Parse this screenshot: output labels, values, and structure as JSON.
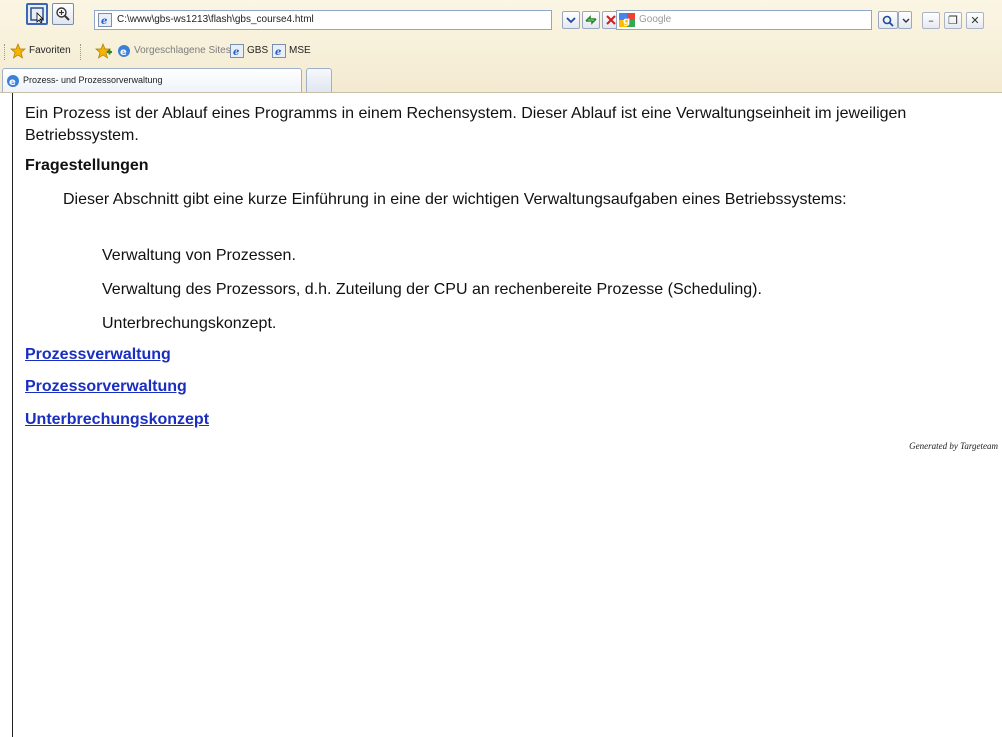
{
  "toolbar": {
    "select_tool_icon": "pointer-select-icon",
    "zoom_tool_icon": "magnifier-plus-icon"
  },
  "address_bar": {
    "url": "C:\\www\\gbs-ws1213\\flash\\gbs_course4.html",
    "icon": "ie-page-icon"
  },
  "nav_buttons": [
    "dropdown-arrow-icon",
    "refresh-icon",
    "stop-icon"
  ],
  "search": {
    "placeholder": "Google",
    "icon": "google-icon"
  },
  "window_buttons": {
    "minimize": "–",
    "restore": "❐",
    "close": "✕"
  },
  "favorites_bar": {
    "favorites_label": "Favoriten",
    "suggested_sites_label": "Vorgeschlagene Sites ▾",
    "links": [
      "GBS",
      "MSE"
    ]
  },
  "tabs": [
    {
      "label": "Prozess- und Prozessorverwaltung"
    }
  ],
  "page": {
    "intro": "Ein Prozess ist der Ablauf eines Programms in einem Rechensystem. Dieser Ablauf ist eine Verwaltungseinheit im jeweiligen Betriebssystem.",
    "heading": "Fragestellungen",
    "description": "Dieser Abschnitt gibt eine kurze Einführung in eine der wichtigen Verwaltungsaufgaben eines Betriebssystems:",
    "items": [
      "Verwaltung von Prozessen.",
      "Verwaltung des Prozessors, d.h. Zuteilung der CPU an rechenbereite Prozesse (Scheduling).",
      "Unterbrechungskonzept."
    ],
    "links": [
      "Prozessverwaltung",
      "Prozessorverwaltung",
      "Unterbrechungskonzept"
    ],
    "footer": "Generated by Targeteam"
  },
  "colors": {
    "link": "#1a2fbf",
    "chrome": "#f3ead0"
  }
}
